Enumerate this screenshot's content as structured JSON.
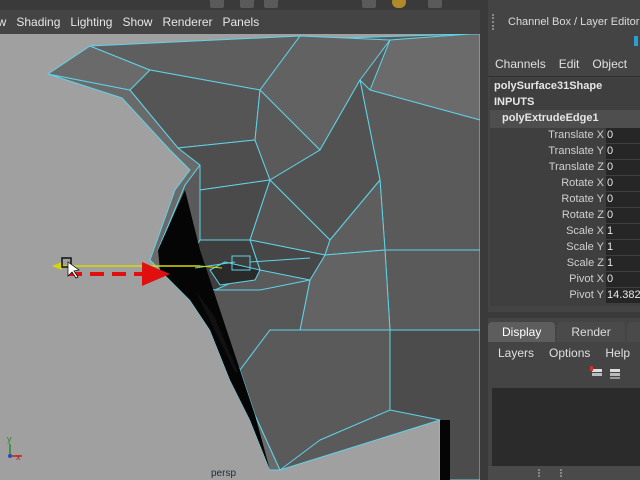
{
  "viewport": {
    "menus": [
      "ew",
      "Shading",
      "Lighting",
      "Show",
      "Renderer",
      "Panels"
    ],
    "camera_label": "persp",
    "axis": {
      "x": "x",
      "y": "y"
    },
    "wire_color": "#5fd3e8",
    "arrow_color": "#e01010"
  },
  "channel_box": {
    "title": "Channel Box / Layer Editor",
    "menus": [
      "Channels",
      "Edit",
      "Object",
      "S"
    ],
    "shape_name": "polySurface31Shape",
    "inputs_label": "INPUTS",
    "node_name": "polyExtrudeEdge1",
    "attributes": [
      {
        "label": "Translate X",
        "value": "0"
      },
      {
        "label": "Translate Y",
        "value": "0"
      },
      {
        "label": "Translate Z",
        "value": "0"
      },
      {
        "label": "Rotate X",
        "value": "0"
      },
      {
        "label": "Rotate Y",
        "value": "0"
      },
      {
        "label": "Rotate Z",
        "value": "0"
      },
      {
        "label": "Scale X",
        "value": "1"
      },
      {
        "label": "Scale Y",
        "value": "1"
      },
      {
        "label": "Scale Z",
        "value": "1"
      },
      {
        "label": "Pivot X",
        "value": "0"
      },
      {
        "label": "Pivot Y",
        "value": "14.382"
      }
    ]
  },
  "layer_editor": {
    "tabs": [
      "Display",
      "Render",
      "A"
    ],
    "active_tab": "Display",
    "menus": [
      "Layers",
      "Options",
      "Help"
    ],
    "icons": [
      "new-layer-icon",
      "new-layer-selected-icon"
    ]
  }
}
